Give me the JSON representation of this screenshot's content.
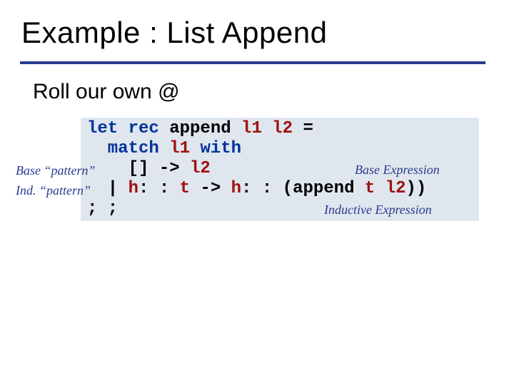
{
  "title": "Example : List Append",
  "subtitle": "Roll our own @",
  "code": {
    "l1_pre": "let rec ",
    "l1_fn": "append ",
    "l1_a1": "l1 ",
    "l1_a2": "l2 ",
    "l1_eq": "=",
    "l2_pre": "  match ",
    "l2_var": "l1 ",
    "l2_post": "with",
    "l3_pre": "    [] -> ",
    "l3_var": "l2",
    "l4_pre": "  | ",
    "l4_h1": "h",
    "l4_c1": ": : ",
    "l4_t1": "t",
    "l4_arr": " -> ",
    "l4_h2": "h",
    "l4_c2": ": : (",
    "l4_fn": "append ",
    "l4_t2": "t ",
    "l4_l2": "l2",
    "l4_close": "))",
    "l5": "; ;"
  },
  "callouts": {
    "base_pattern": "Base “pattern”",
    "ind_pattern": "Ind. “pattern”",
    "base_expression": "Base Expression",
    "inductive_expression": "Inductive Expression"
  }
}
